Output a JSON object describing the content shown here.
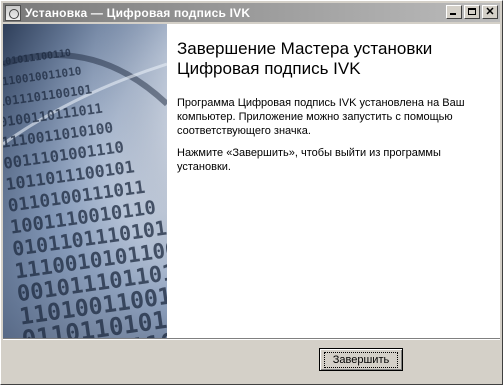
{
  "window": {
    "title": "Установка — Цифровая подпись IVK",
    "icon": "installer-app-icon"
  },
  "titlebar_buttons": [
    {
      "name": "minimize-icon"
    },
    {
      "name": "maximize-icon"
    },
    {
      "name": "close-icon"
    }
  ],
  "side_art": {
    "binary_rows": [
      "1101011100110",
      "0110010011010",
      "1011101100101",
      "0100110111011",
      "1110011010100",
      "0011101001110",
      "1011011100101",
      "0110100111011",
      "1001110010110",
      "0101101110101",
      "1110010101100",
      "0010111011010",
      "1101001100111",
      "0110110101001",
      "1011100110110"
    ]
  },
  "main": {
    "heading": "Завершение Мастера установки Цифровая подпись IVK",
    "paragraph1": "Программа Цифровая подпись IVK установлена на Ваш компьютер. Приложение можно запустить с помощью соответствующего значка.",
    "paragraph2": "Нажмите «Завершить», чтобы выйти из программы установки."
  },
  "buttons": {
    "finish_label": "Завершить"
  }
}
